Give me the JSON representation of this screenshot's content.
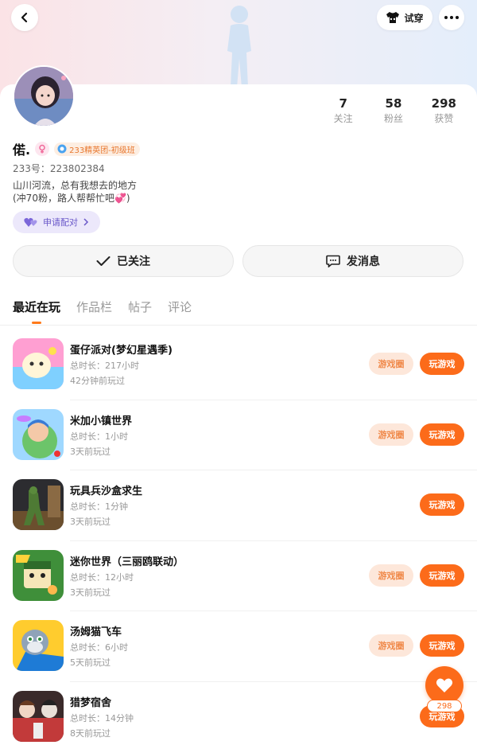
{
  "header": {
    "back_icon": "chevron-left-icon",
    "tryon_label": "试穿",
    "tryon_icon": "tshirt-icon",
    "more_icon": "more-dots-icon"
  },
  "profile": {
    "name": "偌.",
    "gender_icon": "female-icon",
    "guild_badge": "233精英团-初级班",
    "uid": "233号：223802384",
    "bio_line1": "山川河流，总有我想去的地方",
    "bio_line2": "(冲70粉，路人帮帮忙吧💞)",
    "pair_button": "申请配对",
    "stats": [
      {
        "value": "7",
        "label": "关注"
      },
      {
        "value": "58",
        "label": "粉丝"
      },
      {
        "value": "298",
        "label": "获赞"
      }
    ]
  },
  "actions": {
    "followed_label": "已关注",
    "message_label": "发消息"
  },
  "tabs": [
    {
      "label": "最近在玩",
      "active": true
    },
    {
      "label": "作品栏",
      "active": false
    },
    {
      "label": "帖子",
      "active": false
    },
    {
      "label": "评论",
      "active": false
    }
  ],
  "games": [
    {
      "title": "蛋仔派对(梦幻星遇季)",
      "duration": "总时长：217小时",
      "last_played": "42分钟前玩过",
      "circle": "游戏圈",
      "play": "玩游戏",
      "has_circle": true
    },
    {
      "title": "米加小镇世界",
      "duration": "总时长：1小时",
      "last_played": "3天前玩过",
      "circle": "游戏圈",
      "play": "玩游戏",
      "has_circle": true
    },
    {
      "title": "玩具兵沙盒求生",
      "duration": "总时长：1分钟",
      "last_played": "3天前玩过",
      "circle": "",
      "play": "玩游戏",
      "has_circle": false
    },
    {
      "title": "迷你世界（三丽鸥联动）",
      "duration": "总时长：12小时",
      "last_played": "3天前玩过",
      "circle": "游戏圈",
      "play": "玩游戏",
      "has_circle": true
    },
    {
      "title": "汤姆猫飞车",
      "duration": "总时长：6小时",
      "last_played": "5天前玩过",
      "circle": "游戏圈",
      "play": "玩游戏",
      "has_circle": true
    },
    {
      "title": "猎梦宿舍",
      "duration": "总时长：14分钟",
      "last_played": "8天前玩过",
      "circle": "",
      "play": "玩游戏",
      "has_circle": false
    }
  ],
  "like_fab": {
    "icon": "heart-icon",
    "count": "298"
  },
  "colors": {
    "accent": "#fc6b1a",
    "accent_soft": "#fde7da",
    "pair_bg": "#ece8fb",
    "pair_text": "#6a58c9"
  }
}
